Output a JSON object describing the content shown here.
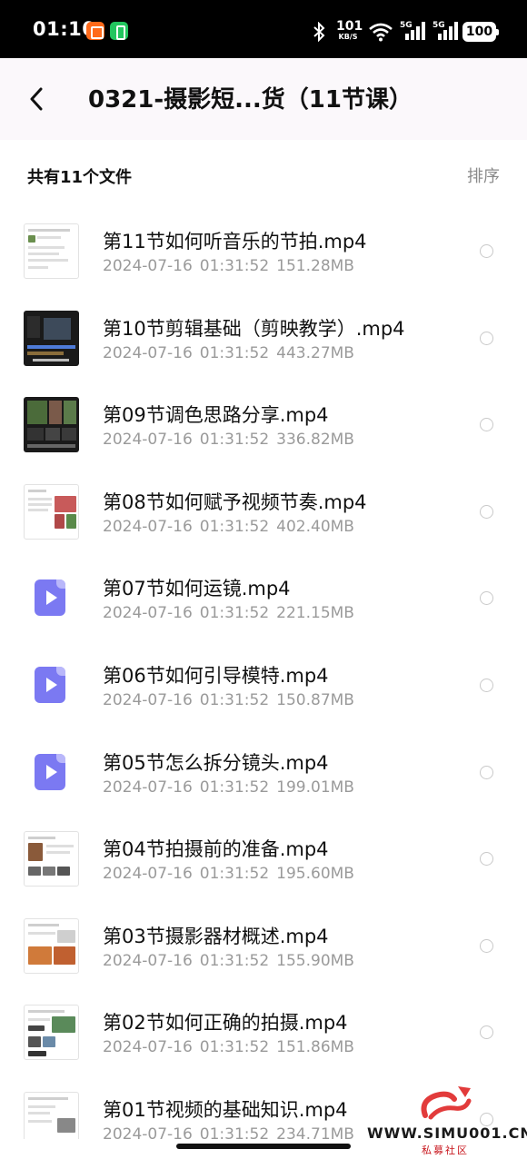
{
  "status_bar": {
    "time": "01:10",
    "net_speed_value": "101",
    "net_speed_unit": "KB/S",
    "sig1_label": "5G",
    "sig2_label": "5G",
    "battery": "100"
  },
  "header": {
    "title": "0321-摄影短...货（11节课）"
  },
  "sub_bar": {
    "count_label": "共有11个文件",
    "sort_label": "排序"
  },
  "files": [
    {
      "name": "第11节如何听音乐的节拍.mp4",
      "date": "2024-07-16",
      "time": "01:31:52",
      "size": "151.28MB",
      "thumb": "doc-chat"
    },
    {
      "name": "第10节剪辑基础（剪映教学）.mp4",
      "date": "2024-07-16",
      "time": "01:31:52",
      "size": "443.27MB",
      "thumb": "dark-editor"
    },
    {
      "name": "第09节调色思路分享.mp4",
      "date": "2024-07-16",
      "time": "01:31:52",
      "size": "336.82MB",
      "thumb": "dark-color"
    },
    {
      "name": "第08节如何赋予视频节奏.mp4",
      "date": "2024-07-16",
      "time": "01:31:52",
      "size": "402.40MB",
      "thumb": "doc-photos"
    },
    {
      "name": "第07节如何运镜.mp4",
      "date": "2024-07-16",
      "time": "01:31:52",
      "size": "221.15MB",
      "thumb": "video-icon"
    },
    {
      "name": "第06节如何引导模特.mp4",
      "date": "2024-07-16",
      "time": "01:31:52",
      "size": "150.87MB",
      "thumb": "video-icon"
    },
    {
      "name": "第05节怎么拆分镜头.mp4",
      "date": "2024-07-16",
      "time": "01:31:52",
      "size": "199.01MB",
      "thumb": "video-icon"
    },
    {
      "name": "第04节拍摄前的准备.mp4",
      "date": "2024-07-16",
      "time": "01:31:52",
      "size": "195.60MB",
      "thumb": "doc-portrait"
    },
    {
      "name": "第03节摄影器材概述.mp4",
      "date": "2024-07-16",
      "time": "01:31:52",
      "size": "155.90MB",
      "thumb": "doc-sunset"
    },
    {
      "name": "第02节如何正确的拍摄.mp4",
      "date": "2024-07-16",
      "time": "01:31:52",
      "size": "151.86MB",
      "thumb": "doc-landscape"
    },
    {
      "name": "第01节视频的基础知识.mp4",
      "date": "2024-07-16",
      "time": "01:31:52",
      "size": "234.71MB",
      "thumb": "doc-basic"
    }
  ],
  "watermark": {
    "text": "WWW.SIMU001.CN",
    "sub": "私募社区"
  },
  "colors": {
    "accent_video": "#7b79f2",
    "header_bg": "#fbf8fb",
    "meta_text": "#9a9a9a",
    "watermark_red": "#c8161d"
  }
}
